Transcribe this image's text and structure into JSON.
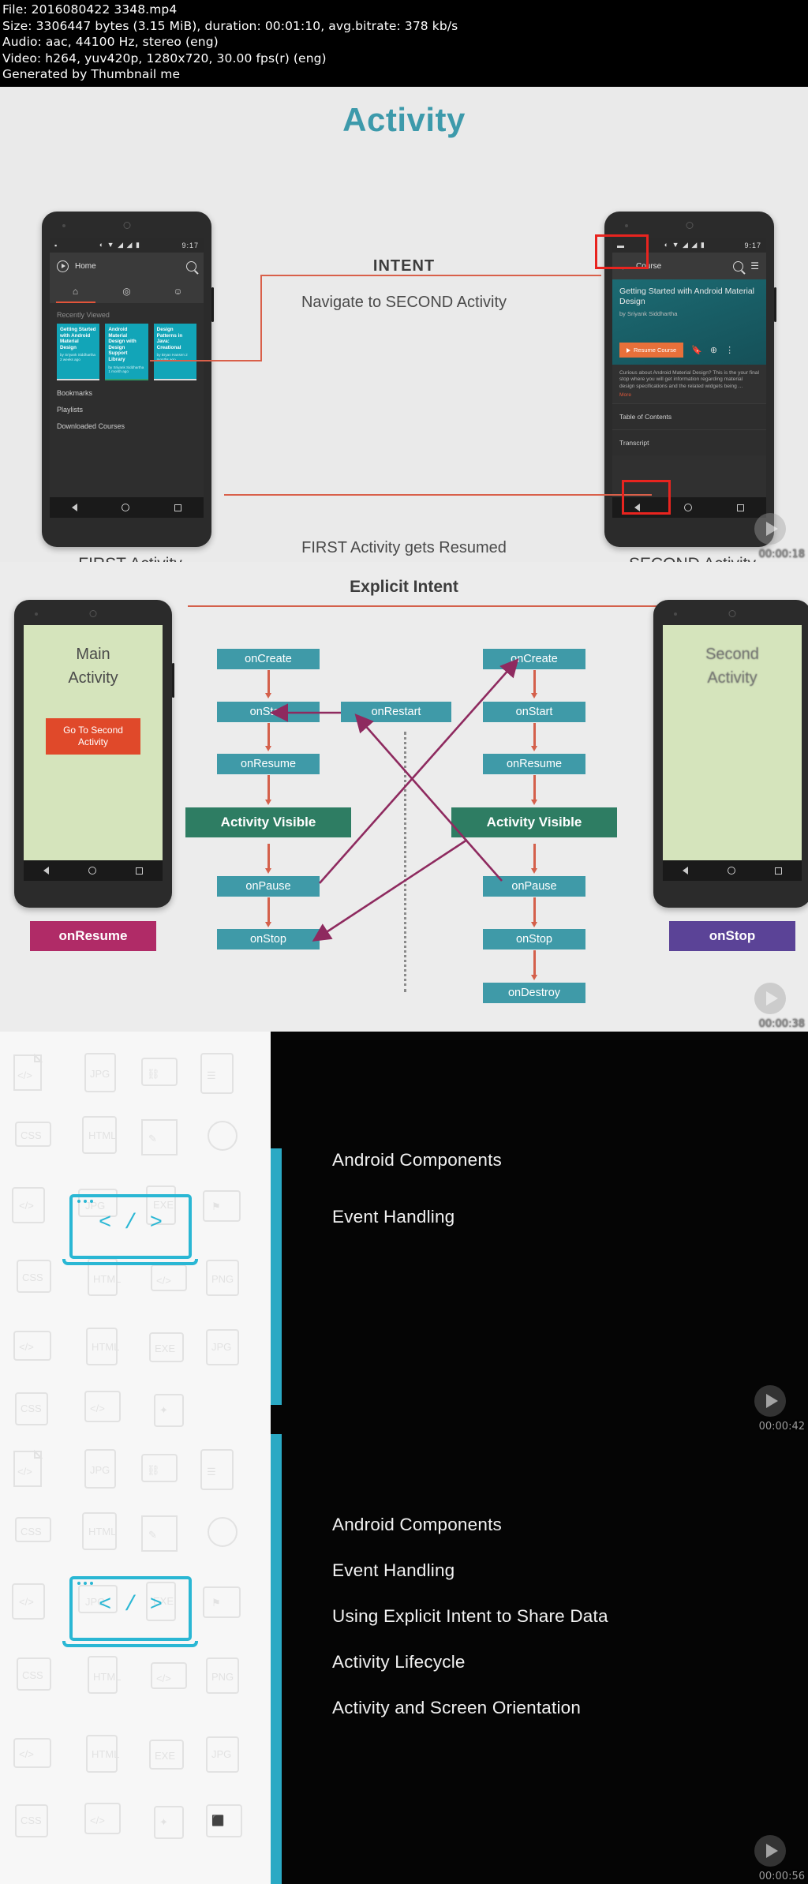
{
  "meta": {
    "file": "File: 2016080422 3348.mp4",
    "size": "Size: 3306447 bytes (3.15 MiB), duration: 00:01:10, avg.bitrate: 378 kb/s",
    "audio": "Audio: aac, 44100 Hz, stereo (eng)",
    "video": "Video: h264, yuv420p, 1280x720, 30.00 fps(r) (eng)",
    "generator": "Generated by Thumbnail me"
  },
  "colors": {
    "accent_teal": "#3d9aab",
    "arrow_red": "#d9604a",
    "box_teal": "#3f9aa8",
    "box_green": "#2e7d63",
    "badge_pink": "#b02b67",
    "badge_purple": "#5b4397",
    "agenda_accent": "#2aa9c4"
  },
  "frames": [
    {
      "timestamp": "00:00:18",
      "title": "Activity",
      "intent_label": "INTENT",
      "navigate_text": "Navigate to SECOND Activity",
      "resume_text": "FIRST Activity gets Resumed",
      "caption_left": "FIRST Activity",
      "caption_right": "SECOND Activity",
      "phone_first": {
        "status_time": "9:17",
        "status_icons": "◐ ▼ ◢ ◢ ▮",
        "app_title": "Home",
        "section": "Recently Viewed",
        "cards": [
          {
            "title": "Getting Started with Android Material Design",
            "meta": "by Sriyank Siddhartha\n2 weeks ago"
          },
          {
            "title": "Android Material Design with Design Support Library",
            "meta": "by Sriyank Siddhartha\n1 month ago"
          },
          {
            "title": "Design Patterns in Java: Creational",
            "meta": "by Bryan Hansen\n2 months ago"
          }
        ],
        "rows": [
          "Bookmarks",
          "Playlists",
          "Downloaded Courses"
        ]
      },
      "phone_second": {
        "status_time": "9:17",
        "app_title": "Course",
        "hero_title": "Getting Started with Android Material Design",
        "hero_author": "by Sriyank Siddhartha",
        "resume_button": "Resume Course",
        "description": "Curious about Android Material Design? This is the your final stop where you will get information regarding material design specifications and the related widgets being ...",
        "more_link": "More",
        "rows": [
          "Table of Contents",
          "Transcript"
        ]
      }
    },
    {
      "timestamp": "00:00:38",
      "title": "Explicit Intent",
      "left_phone": {
        "screen_title": "Main\nActivity",
        "button": "Go To Second\nActivity",
        "badge": "onResume"
      },
      "right_phone": {
        "screen_title": "Second\nActivity",
        "badge": "onStop"
      },
      "left_lifecycle": [
        "onCreate",
        "onStart",
        "onResume",
        "Activity Visible",
        "onPause",
        "onStop"
      ],
      "restart_box": "onRestart",
      "right_lifecycle": [
        "onCreate",
        "onStart",
        "onResume",
        "Activity Visible",
        "onPause",
        "onStop",
        "onDestroy"
      ]
    },
    {
      "timestamp": "00:00:42",
      "items": [
        "Android Components",
        "Event Handling"
      ]
    },
    {
      "timestamp": "00:00:56",
      "items": [
        "Android Components",
        "Event Handling",
        "Using Explicit Intent to Share Data",
        "Activity Lifecycle",
        "Activity and Screen Orientation"
      ]
    }
  ]
}
